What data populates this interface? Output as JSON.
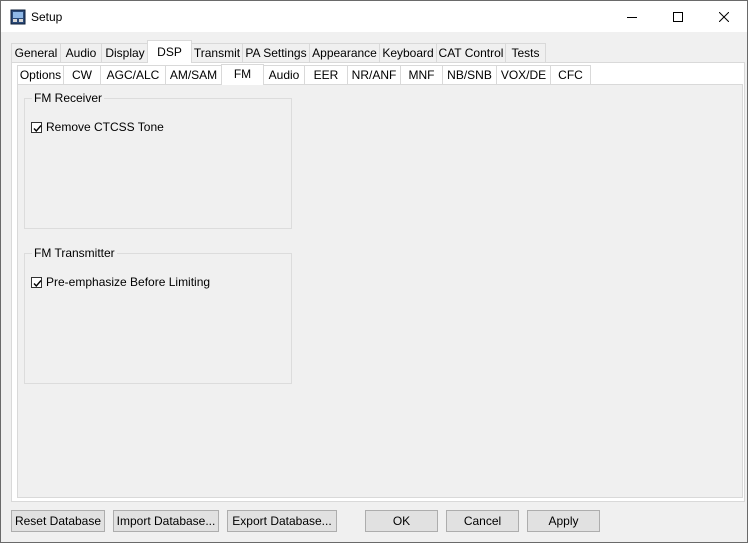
{
  "window": {
    "title": "Setup",
    "icon": "setup-app-icon"
  },
  "main_tabs": [
    {
      "label": "General"
    },
    {
      "label": "Audio"
    },
    {
      "label": "Display"
    },
    {
      "label": "DSP",
      "selected": true
    },
    {
      "label": "Transmit"
    },
    {
      "label": "PA Settings"
    },
    {
      "label": "Appearance"
    },
    {
      "label": "Keyboard"
    },
    {
      "label": "CAT Control"
    },
    {
      "label": "Tests"
    }
  ],
  "dsp_tabs": [
    {
      "label": "Options"
    },
    {
      "label": "CW"
    },
    {
      "label": "AGC/ALC"
    },
    {
      "label": "AM/SAM"
    },
    {
      "label": "FM",
      "selected": true
    },
    {
      "label": "Audio"
    },
    {
      "label": "EER"
    },
    {
      "label": "NR/ANF"
    },
    {
      "label": "MNF"
    },
    {
      "label": "NB/SNB"
    },
    {
      "label": "VOX/DE"
    },
    {
      "label": "CFC"
    }
  ],
  "fm_receiver": {
    "title": "FM Receiver",
    "remove_ctcss_label": "Remove CTCSS Tone",
    "remove_ctcss_checked": true
  },
  "fm_transmitter": {
    "title": "FM Transmitter",
    "preemph_label": "Pre-emphasize Before Limiting",
    "preemph_checked": true
  },
  "buttons": {
    "reset_db": "Reset Database",
    "import_db": "Import Database...",
    "export_db": "Export Database...",
    "ok": "OK",
    "cancel": "Cancel",
    "apply": "Apply"
  }
}
